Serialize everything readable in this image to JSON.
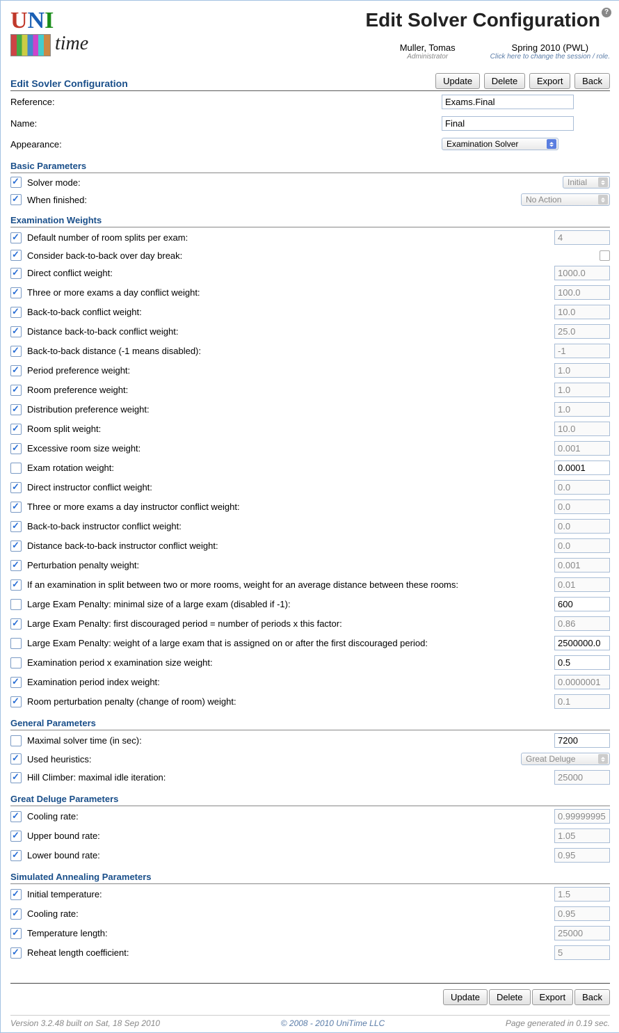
{
  "page_title": "Edit Solver Configuration",
  "user": {
    "name": "Muller, Tomas",
    "role": "Administrator"
  },
  "session": {
    "name": "Spring 2010 (PWL)",
    "hint": "Click here to change the session / role."
  },
  "section_title": "Edit Sovler Configuration",
  "buttons": {
    "update": "Update",
    "delete": "Delete",
    "export": "Export",
    "back": "Back"
  },
  "top_form": {
    "reference_label": "Reference:",
    "reference_value": "Exams.Final",
    "name_label": "Name:",
    "name_value": "Final",
    "appearance_label": "Appearance:",
    "appearance_value": "Examination Solver"
  },
  "sections": {
    "basic": {
      "title": "Basic Parameters",
      "params": [
        {
          "checked": true,
          "label": "Solver mode:",
          "type": "select",
          "value": "Initial",
          "disabled": true
        },
        {
          "checked": true,
          "label": "When finished:",
          "type": "select-wide",
          "value": "No Action",
          "disabled": true
        }
      ]
    },
    "exam": {
      "title": "Examination Weights",
      "params": [
        {
          "checked": true,
          "label": "Default number of room splits per exam:",
          "type": "text",
          "value": "4",
          "disabled": true
        },
        {
          "checked": true,
          "label": "Consider back-to-back over day break:",
          "type": "checkbox",
          "value": "",
          "disabled": true
        },
        {
          "checked": true,
          "label": "Direct conflict weight:",
          "type": "text",
          "value": "1000.0",
          "disabled": true
        },
        {
          "checked": true,
          "label": "Three or more exams a day conflict weight:",
          "type": "text",
          "value": "100.0",
          "disabled": true
        },
        {
          "checked": true,
          "label": "Back-to-back conflict weight:",
          "type": "text",
          "value": "10.0",
          "disabled": true
        },
        {
          "checked": true,
          "label": "Distance back-to-back conflict weight:",
          "type": "text",
          "value": "25.0",
          "disabled": true
        },
        {
          "checked": true,
          "label": "Back-to-back distance (-1 means disabled):",
          "type": "text",
          "value": "-1",
          "disabled": true
        },
        {
          "checked": true,
          "label": "Period preference weight:",
          "type": "text",
          "value": "1.0",
          "disabled": true
        },
        {
          "checked": true,
          "label": "Room preference weight:",
          "type": "text",
          "value": "1.0",
          "disabled": true
        },
        {
          "checked": true,
          "label": "Distribution preference weight:",
          "type": "text",
          "value": "1.0",
          "disabled": true
        },
        {
          "checked": true,
          "label": "Room split weight:",
          "type": "text",
          "value": "10.0",
          "disabled": true
        },
        {
          "checked": true,
          "label": "Excessive room size weight:",
          "type": "text",
          "value": "0.001",
          "disabled": true
        },
        {
          "checked": false,
          "label": "Exam rotation weight:",
          "type": "text",
          "value": "0.0001",
          "disabled": false
        },
        {
          "checked": true,
          "label": "Direct instructor conflict weight:",
          "type": "text",
          "value": "0.0",
          "disabled": true
        },
        {
          "checked": true,
          "label": "Three or more exams a day instructor conflict weight:",
          "type": "text",
          "value": "0.0",
          "disabled": true
        },
        {
          "checked": true,
          "label": "Back-to-back instructor conflict weight:",
          "type": "text",
          "value": "0.0",
          "disabled": true
        },
        {
          "checked": true,
          "label": "Distance back-to-back instructor conflict weight:",
          "type": "text",
          "value": "0.0",
          "disabled": true
        },
        {
          "checked": true,
          "label": "Perturbation penalty weight:",
          "type": "text",
          "value": "0.001",
          "disabled": true
        },
        {
          "checked": true,
          "label": "If an examination in split between two or more rooms, weight for an average distance between these rooms:",
          "type": "text",
          "value": "0.01",
          "disabled": true
        },
        {
          "checked": false,
          "label": "Large Exam Penalty: minimal size of a large exam (disabled if -1):",
          "type": "text",
          "value": "600",
          "disabled": false
        },
        {
          "checked": true,
          "label": "Large Exam Penalty: first discouraged period = number of periods x this factor:",
          "type": "text",
          "value": "0.86",
          "disabled": true
        },
        {
          "checked": false,
          "label": "Large Exam Penalty: weight of a large exam that is assigned on or after the first discouraged period:",
          "type": "text",
          "value": "2500000.0",
          "disabled": false
        },
        {
          "checked": false,
          "label": "Examination period x examination size weight:",
          "type": "text",
          "value": "0.5",
          "disabled": false
        },
        {
          "checked": true,
          "label": "Examination period index weight:",
          "type": "text",
          "value": "0.0000001",
          "disabled": true
        },
        {
          "checked": true,
          "label": "Room perturbation penalty (change of room) weight:",
          "type": "text",
          "value": "0.1",
          "disabled": true
        }
      ]
    },
    "general": {
      "title": "General Parameters",
      "params": [
        {
          "checked": false,
          "label": "Maximal solver time (in sec):",
          "type": "text",
          "value": "7200",
          "disabled": false
        },
        {
          "checked": true,
          "label": "Used heuristics:",
          "type": "select-wide",
          "value": "Great Deluge",
          "disabled": true
        },
        {
          "checked": true,
          "label": "Hill Climber: maximal idle iteration:",
          "type": "text",
          "value": "25000",
          "disabled": true
        }
      ]
    },
    "deluge": {
      "title": "Great Deluge Parameters",
      "params": [
        {
          "checked": true,
          "label": "Cooling rate:",
          "type": "text",
          "value": "0.99999995",
          "disabled": true
        },
        {
          "checked": true,
          "label": "Upper bound rate:",
          "type": "text",
          "value": "1.05",
          "disabled": true
        },
        {
          "checked": true,
          "label": "Lower bound rate:",
          "type": "text",
          "value": "0.95",
          "disabled": true
        }
      ]
    },
    "annealing": {
      "title": "Simulated Annealing Parameters",
      "params": [
        {
          "checked": true,
          "label": "Initial temperature:",
          "type": "text",
          "value": "1.5",
          "disabled": true
        },
        {
          "checked": true,
          "label": "Cooling rate:",
          "type": "text",
          "value": "0.95",
          "disabled": true
        },
        {
          "checked": true,
          "label": "Temperature length:",
          "type": "text",
          "value": "25000",
          "disabled": true
        },
        {
          "checked": true,
          "label": "Reheat length coefficient:",
          "type": "text",
          "value": "5",
          "disabled": true
        }
      ]
    }
  },
  "footer": {
    "left": "Version 3.2.48 built on Sat, 18 Sep 2010",
    "center": "© 2008 - 2010 UniTime LLC",
    "right": "Page generated in 0.19 sec."
  }
}
